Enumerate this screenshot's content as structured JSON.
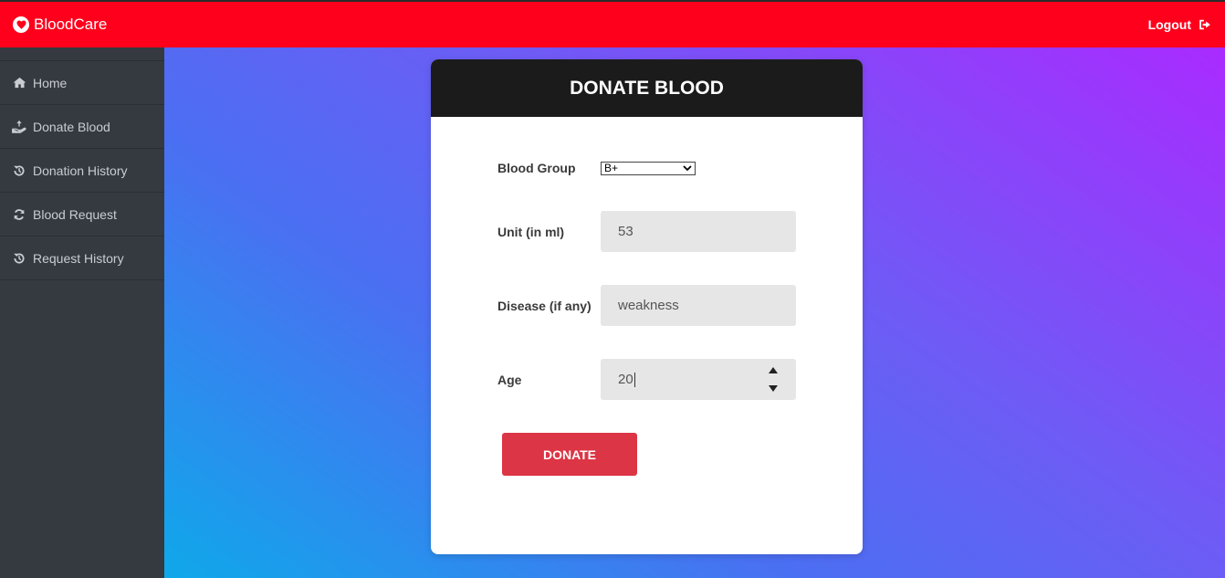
{
  "header": {
    "brand": "BloodCare",
    "logout_label": "Logout"
  },
  "sidebar": {
    "items": [
      {
        "label": "Home",
        "icon": "home-icon"
      },
      {
        "label": "Donate Blood",
        "icon": "hand-holding-icon"
      },
      {
        "label": "Donation History",
        "icon": "history-icon"
      },
      {
        "label": "Blood Request",
        "icon": "refresh-icon"
      },
      {
        "label": "Request History",
        "icon": "history-icon"
      }
    ]
  },
  "card": {
    "title": "DONATE BLOOD",
    "fields": {
      "blood_group": {
        "label": "Blood Group",
        "value": "B+"
      },
      "unit": {
        "label": "Unit (in ml)",
        "value": "53"
      },
      "disease": {
        "label": "Disease (if any)",
        "value": "weakness"
      },
      "age": {
        "label": "Age",
        "value": "20"
      }
    },
    "submit_label": "DONATE"
  },
  "colors": {
    "topbar": "#ff001c",
    "sidebar": "#343a40",
    "card_header": "#1b1b1b",
    "button": "#dc3545",
    "gradient_start": "#0fa8ea",
    "gradient_end": "#a92bff"
  }
}
